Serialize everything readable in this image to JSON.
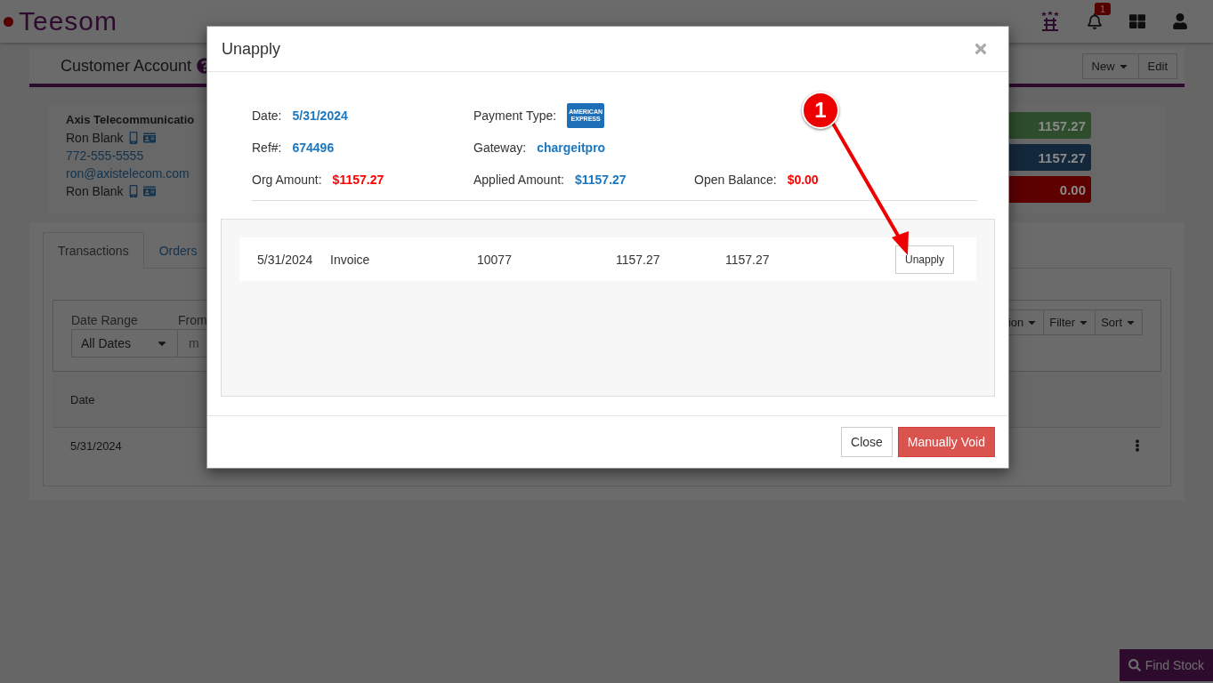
{
  "header": {
    "logo": "Teesom",
    "notification_count": "1"
  },
  "page_title": {
    "title": "Customer Account",
    "buttons": [
      {
        "label": "New",
        "dropdown": true
      },
      {
        "label": "Edit",
        "dropdown": false
      }
    ]
  },
  "customer": {
    "company": "Axis Telecommunicatio",
    "lines": [
      {
        "kind": "contact",
        "text": "Ron Blank"
      },
      {
        "kind": "link",
        "text": "772-555-5555"
      },
      {
        "kind": "link",
        "text": "ron@axistelecom.com"
      },
      {
        "kind": "contact",
        "text": "Ron Blank"
      }
    ],
    "balances": [
      {
        "amount": "1157.27",
        "color": "#2d4d2d"
      },
      {
        "amount": "1157.27",
        "color": "#14283c"
      },
      {
        "amount": "0.00",
        "color": "#5c0000"
      }
    ]
  },
  "tabs": [
    {
      "label": "Transactions",
      "selected": true
    },
    {
      "label": "Orders",
      "selected": false
    }
  ],
  "filters": {
    "date_range_label": "Date Range",
    "from_label": "From",
    "date_range_value": "All Dates",
    "from_placeholder": "m",
    "buttons": [
      "ion",
      "Filter",
      "Sort"
    ]
  },
  "table": {
    "columns": [
      "Date"
    ],
    "rows": [
      {
        "date": "5/31/2024"
      }
    ]
  },
  "find_stock": "Find Stock",
  "modal": {
    "title": "Unapply",
    "info": [
      {
        "label": "Date:",
        "value": "5/31/2024",
        "kind": "info"
      },
      {
        "label": "Payment Type:",
        "value": "AMERICAN EXPRESS",
        "kind": "logo"
      },
      {
        "label": "Ref#:",
        "value": "674496",
        "kind": "info"
      },
      {
        "label": "Gateway:",
        "value": "chargeitpro",
        "kind": "info"
      },
      {
        "label": "Org Amount:",
        "value": "$1157.27",
        "kind": "danger"
      },
      {
        "label": "Applied Amount:",
        "value": "$1157.27",
        "kind": "info"
      },
      {
        "label": "Open Balance:",
        "value": "$0.00",
        "kind": "danger"
      }
    ],
    "rows": [
      {
        "date": "5/31/2024",
        "type": "Invoice",
        "number": "10077",
        "amount": "1157.27",
        "applied": "1157.27",
        "action": "Unapply"
      }
    ],
    "buttons": [
      {
        "label": "Close",
        "kind": "default"
      },
      {
        "label": "Manually Void",
        "kind": "danger"
      }
    ]
  },
  "annotation": {
    "number": "1"
  }
}
